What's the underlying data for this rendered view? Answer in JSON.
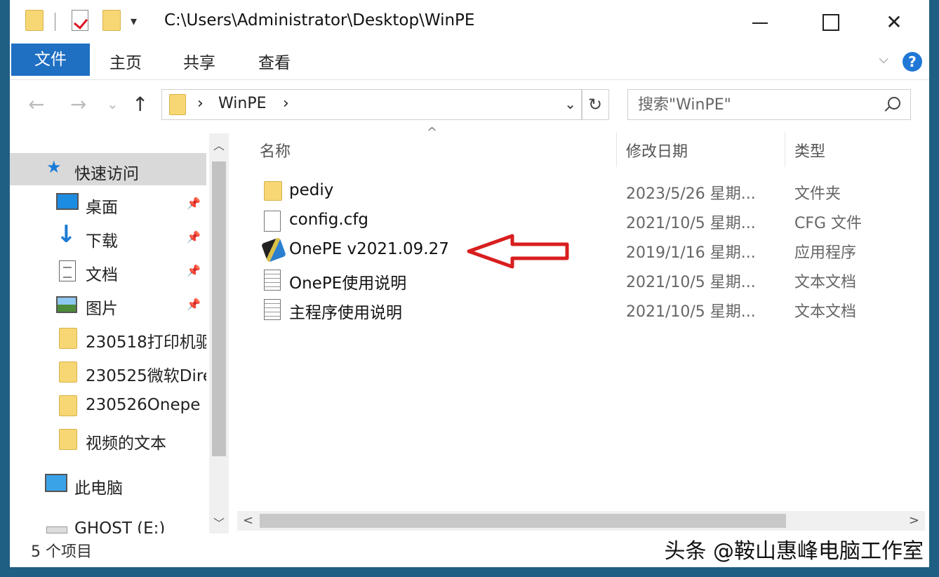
{
  "titlebar": {
    "path": "C:\\Users\\Administrator\\Desktop\\WinPE",
    "dropdown": "▾",
    "close": "✕"
  },
  "ribbon": {
    "tab_file": "文件",
    "tab_home": "主页",
    "tab_share": "共享",
    "tab_view": "查看",
    "chevron": "⌵",
    "help": "?"
  },
  "address": {
    "back": "←",
    "forward": "→",
    "recent": "⌄",
    "up": "↑",
    "sep1": "›",
    "folder": "WinPE",
    "sep2": "›",
    "dropdown": "⌄",
    "refresh": "↻",
    "search_placeholder": "搜索\"WinPE\""
  },
  "navpane": {
    "quick_access": "快速访问",
    "items": [
      {
        "label": "桌面",
        "icon": "desktop-icon",
        "pinned": true
      },
      {
        "label": "下载",
        "icon": "download-icon",
        "pinned": true
      },
      {
        "label": "文档",
        "icon": "document-icon",
        "pinned": true
      },
      {
        "label": "图片",
        "icon": "picture-icon",
        "pinned": true
      },
      {
        "label": "230518打印机驱",
        "icon": "folder-icon",
        "pinned": false
      },
      {
        "label": "230525微软Dire",
        "icon": "folder-icon",
        "pinned": false
      },
      {
        "label": "230526Onepe",
        "icon": "folder-icon",
        "pinned": false
      },
      {
        "label": "视频的文本",
        "icon": "folder-icon",
        "pinned": false
      }
    ],
    "this_pc": "此电脑",
    "drive": "GHOST (E:)",
    "pin_glyph": "📌"
  },
  "columns": {
    "name": "名称",
    "date": "修改日期",
    "type": "类型",
    "sort_arrow": "^"
  },
  "files": [
    {
      "name": "pediy",
      "date": "2023/5/26 星期...",
      "type": "文件夹",
      "icon": "folder-icon"
    },
    {
      "name": "config.cfg",
      "date": "2021/10/5 星期...",
      "type": "CFG 文件",
      "icon": "file-icon"
    },
    {
      "name": "OnePE v2021.09.27",
      "date": "2019/1/16 星期...",
      "type": "应用程序",
      "icon": "application-icon"
    },
    {
      "name": "OnePE使用说明",
      "date": "2021/10/5 星期...",
      "type": "文本文档",
      "icon": "text-file-icon"
    },
    {
      "name": "主程序使用说明",
      "date": "2021/10/5 星期...",
      "type": "文本文档",
      "icon": "text-file-icon"
    }
  ],
  "scroll": {
    "up": "︿",
    "down": "﹀",
    "left": "<",
    "right": ">"
  },
  "status": {
    "count": "5 个项目"
  },
  "watermark": "头条 @鞍山惠峰电脑工作室",
  "colors": {
    "accent": "#1f6fc3",
    "frame": "#1f5f83",
    "annotation": "#d81e1e"
  }
}
